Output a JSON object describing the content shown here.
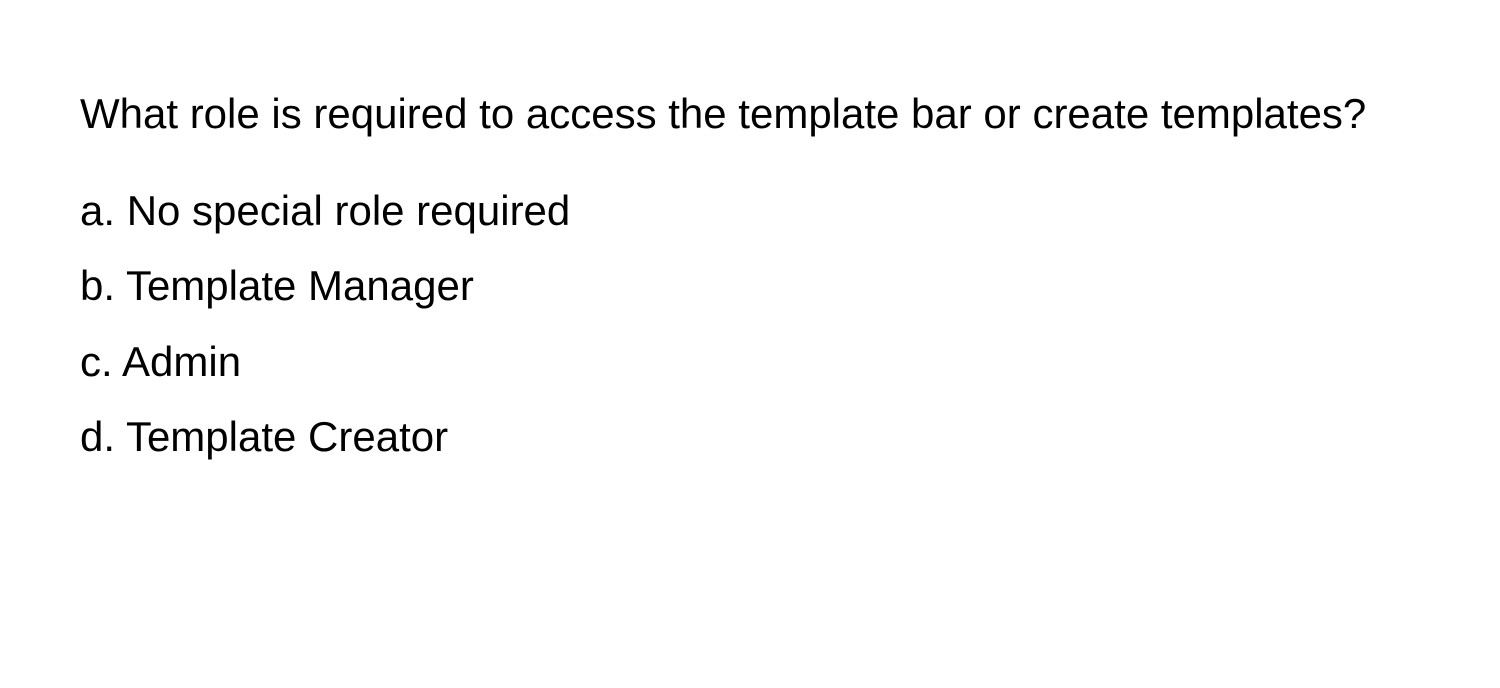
{
  "question": "What role is required to access the template bar or create templates?",
  "options": [
    {
      "label": "a.",
      "text": "No special role required"
    },
    {
      "label": "b.",
      "text": "Template Manager"
    },
    {
      "label": "c.",
      "text": "Admin"
    },
    {
      "label": "d.",
      "text": "Template Creator"
    }
  ]
}
